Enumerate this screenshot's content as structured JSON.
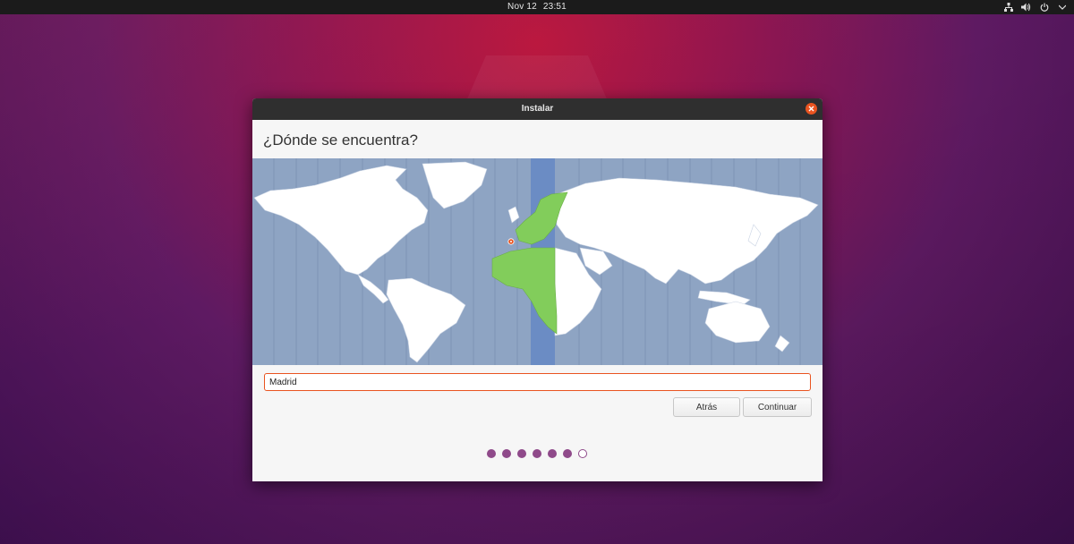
{
  "topbar": {
    "date": "Nov 12",
    "time": "23:51",
    "tray": [
      {
        "icon": "network-icon"
      },
      {
        "icon": "volume-icon"
      },
      {
        "icon": "power-icon"
      },
      {
        "icon": "chevron-down-icon"
      }
    ]
  },
  "window": {
    "title": "Instalar",
    "heading": "¿Dónde se encuentra?",
    "map": {
      "ocean_color": "#8ea4c3",
      "land_color": "#ffffff",
      "highlight_zone_color": "#82cd5b",
      "selected_zone_band_color": "#6b8cc4",
      "selected_city": "Madrid"
    },
    "location_field": {
      "value": "Madrid"
    },
    "buttons": {
      "back_label": "Atrás",
      "continue_label": "Continuar"
    },
    "progress": {
      "total_steps": 7,
      "completed_steps": 6,
      "accent": "#8f4a8a"
    }
  },
  "colors": {
    "accent_orange": "#e95420",
    "topbar_bg": "#1b1b1b",
    "titlebar_bg": "#2f2f2f"
  }
}
